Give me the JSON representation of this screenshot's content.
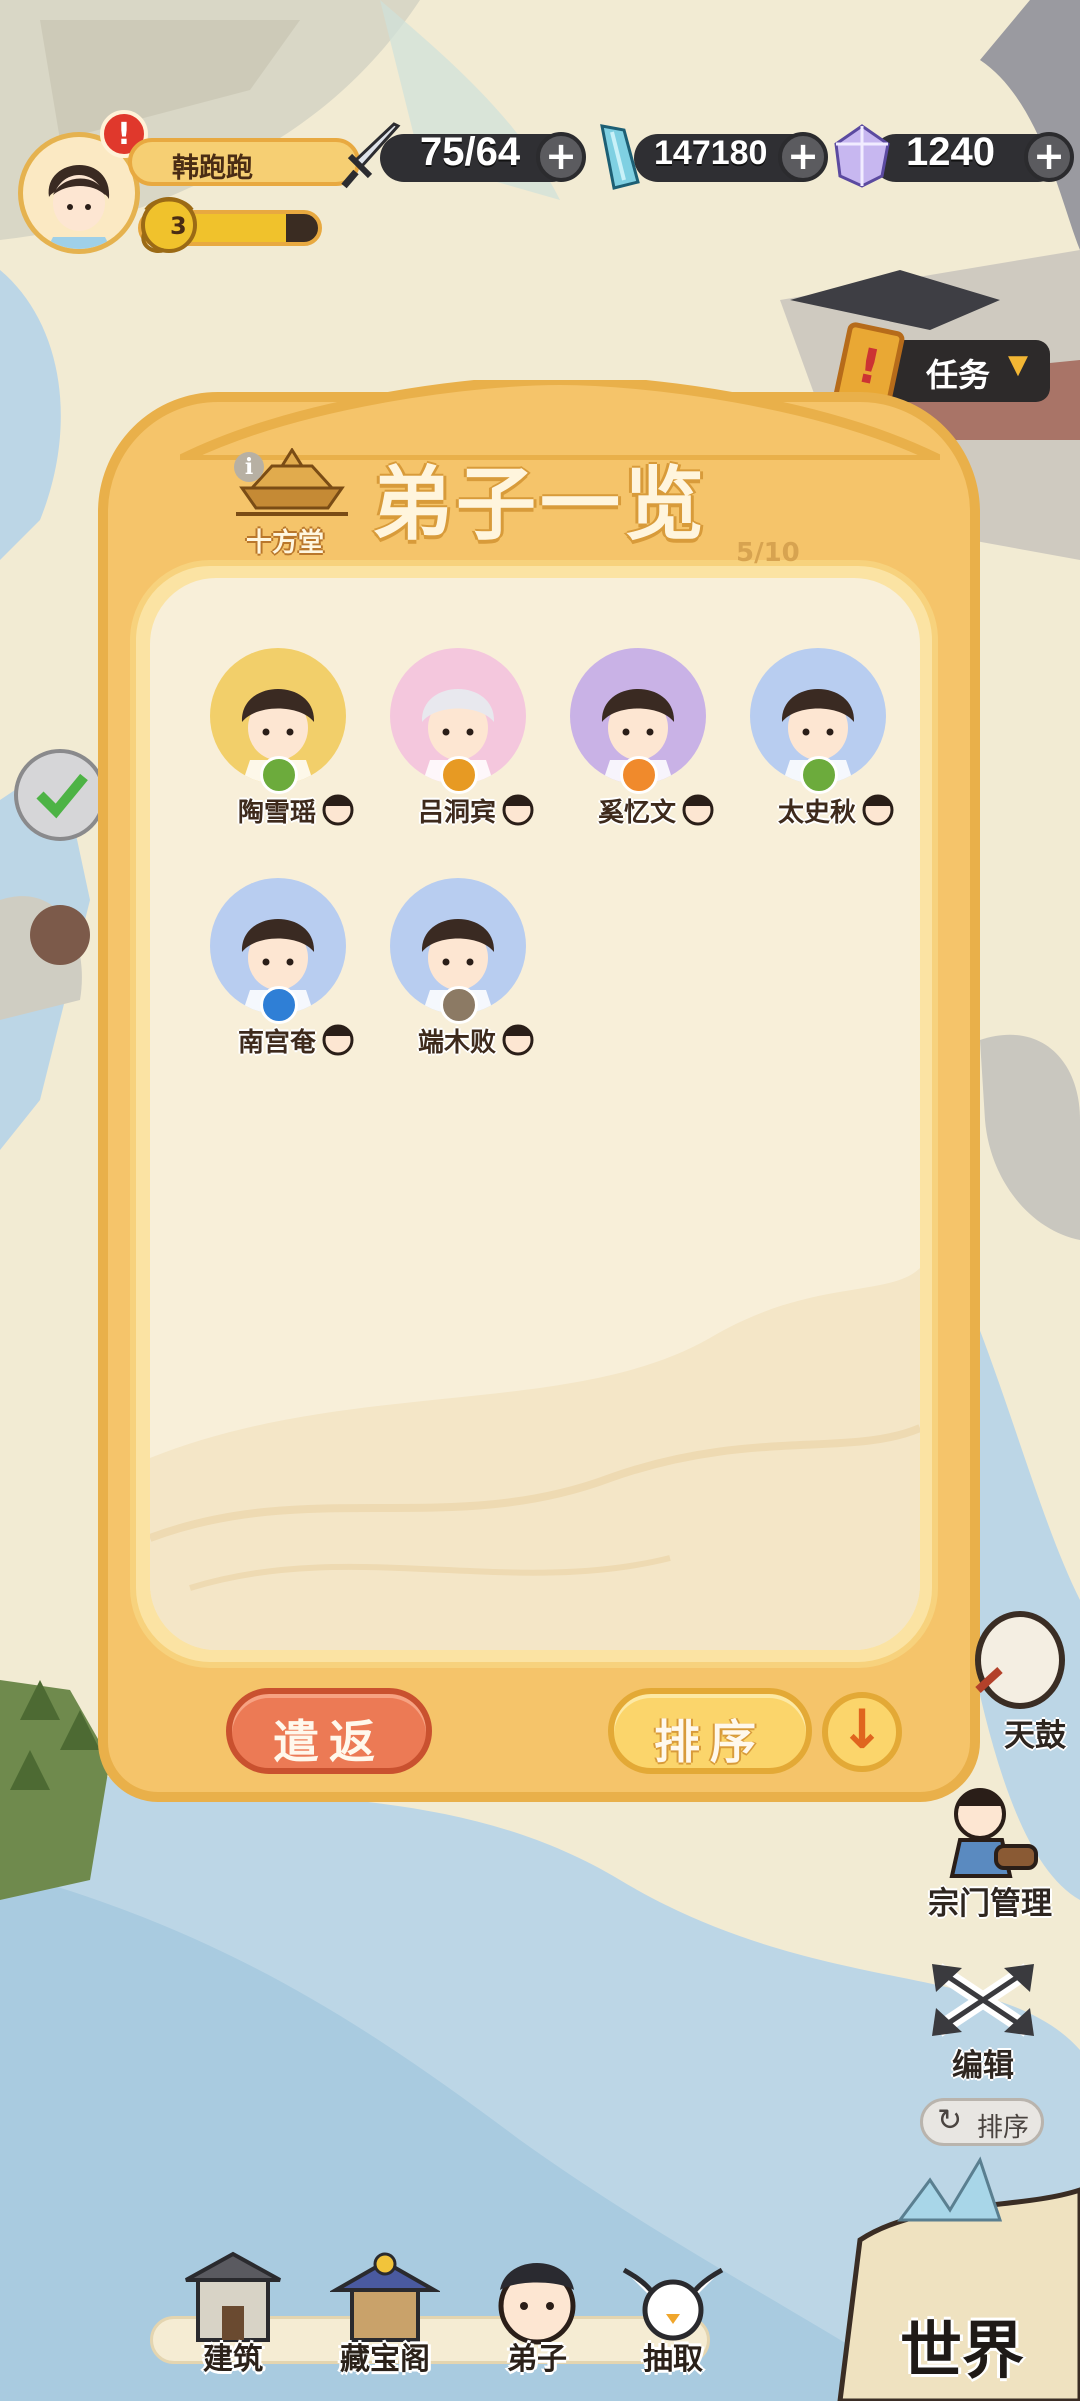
{
  "player": {
    "name": "韩跑跑",
    "level": "3",
    "level_progress": 0.82,
    "has_alert": true
  },
  "resources": {
    "stamina": "75/64",
    "spirit_stones": "147180",
    "gems": "1240"
  },
  "task": {
    "label": "任务"
  },
  "panel": {
    "title": "弟子一览",
    "hall_name": "十方堂",
    "capacity": "5/10",
    "dismiss_label": "遣返",
    "sort_label": "排序",
    "order_icon": "arrow-down-icon"
  },
  "disciples": [
    {
      "name": "陶雪瑶",
      "element": "wood",
      "bg": "#f2cf6a"
    },
    {
      "name": "吕洞宾",
      "element": "gold",
      "bg": "#f4c7dd"
    },
    {
      "name": "奚忆文",
      "element": "fire",
      "bg": "#c9b2e6"
    },
    {
      "name": "太史秋",
      "element": "wood",
      "bg": "#b8cdf0"
    },
    {
      "name": "南宫奄",
      "element": "water",
      "bg": "#b8cdf0"
    },
    {
      "name": "端木败",
      "element": "earth",
      "bg": "#b8cdf0"
    }
  ],
  "element_colors": {
    "wood": "#6cab3c",
    "gold": "#e79a23",
    "fire": "#f08a2c",
    "water": "#2f7fd6",
    "earth": "#8c7a64"
  },
  "side_buttons": {
    "drum": "天鼓",
    "sect_manage": "宗门管理",
    "edit": "编辑",
    "sort": "排序"
  },
  "nav": {
    "build": "建筑",
    "treasury": "藏宝阁",
    "disciples": "弟子",
    "draw": "抽取",
    "world": "世界"
  }
}
